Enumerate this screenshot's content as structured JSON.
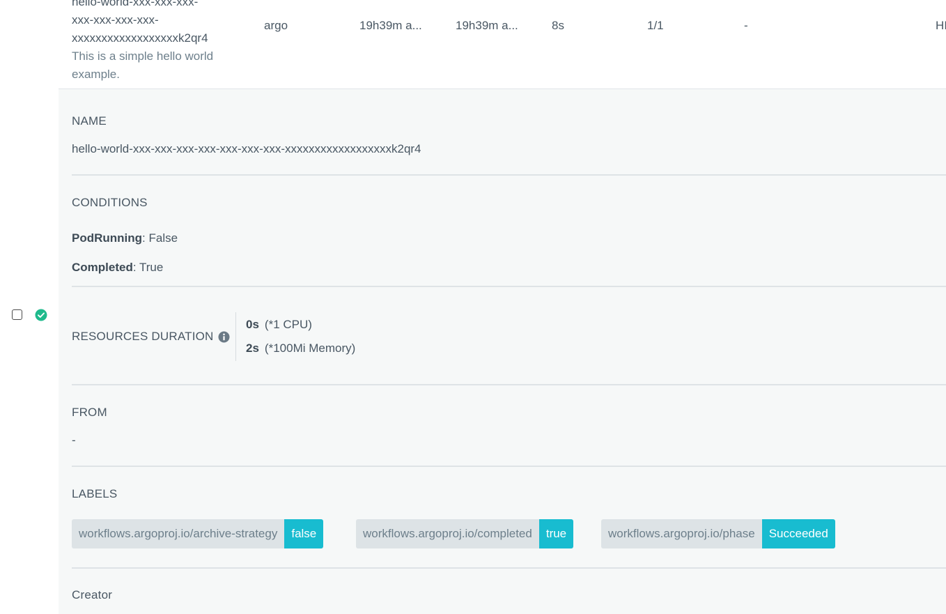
{
  "row": {
    "name_lines": [
      "hello-world-xxx-xxx-xxx-",
      "xxx-xxx-xxx-xxx-",
      "xxxxxxxxxxxxxxxxxxk2qr4"
    ],
    "description_lines": [
      "This is a simple hello world",
      "example."
    ],
    "namespace": "argo",
    "started": "19h39m a...",
    "finished": "19h39m a...",
    "duration": "8s",
    "progress": "1/1",
    "message": "-",
    "truncated_cell": "HI"
  },
  "details": {
    "name_title": "NAME",
    "name_value": "hello-world-xxx-xxx-xxx-xxx-xxx-xxx-xxx-xxxxxxxxxxxxxxxxxxk2qr4",
    "conditions_title": "CONDITIONS",
    "conditions": [
      {
        "key": "PodRunning",
        "value": ": False"
      },
      {
        "key": "Completed",
        "value": ": True"
      }
    ],
    "resources_title": "RESOURCES DURATION",
    "resources": [
      {
        "amount": "0s",
        "unit": "(*1 CPU)"
      },
      {
        "amount": "2s",
        "unit": "(*100Mi Memory)"
      }
    ],
    "from_title": "FROM",
    "from_value": "-",
    "labels_title": "LABELS",
    "labels": [
      {
        "key": "workflows.argoproj.io/archive-strategy",
        "value": "false"
      },
      {
        "key": "workflows.argoproj.io/completed",
        "value": "true"
      },
      {
        "key": "workflows.argoproj.io/phase",
        "value": "Succeeded"
      }
    ],
    "creator_title": "Creator"
  },
  "icons": {
    "status": "check-circle-icon",
    "info": "info-circle-icon"
  },
  "colors": {
    "success": "#1fba8c",
    "label_value_bg": "#18bcd0",
    "label_key_bg": "#dde3e6",
    "panel_bg": "#f6f8f8"
  }
}
